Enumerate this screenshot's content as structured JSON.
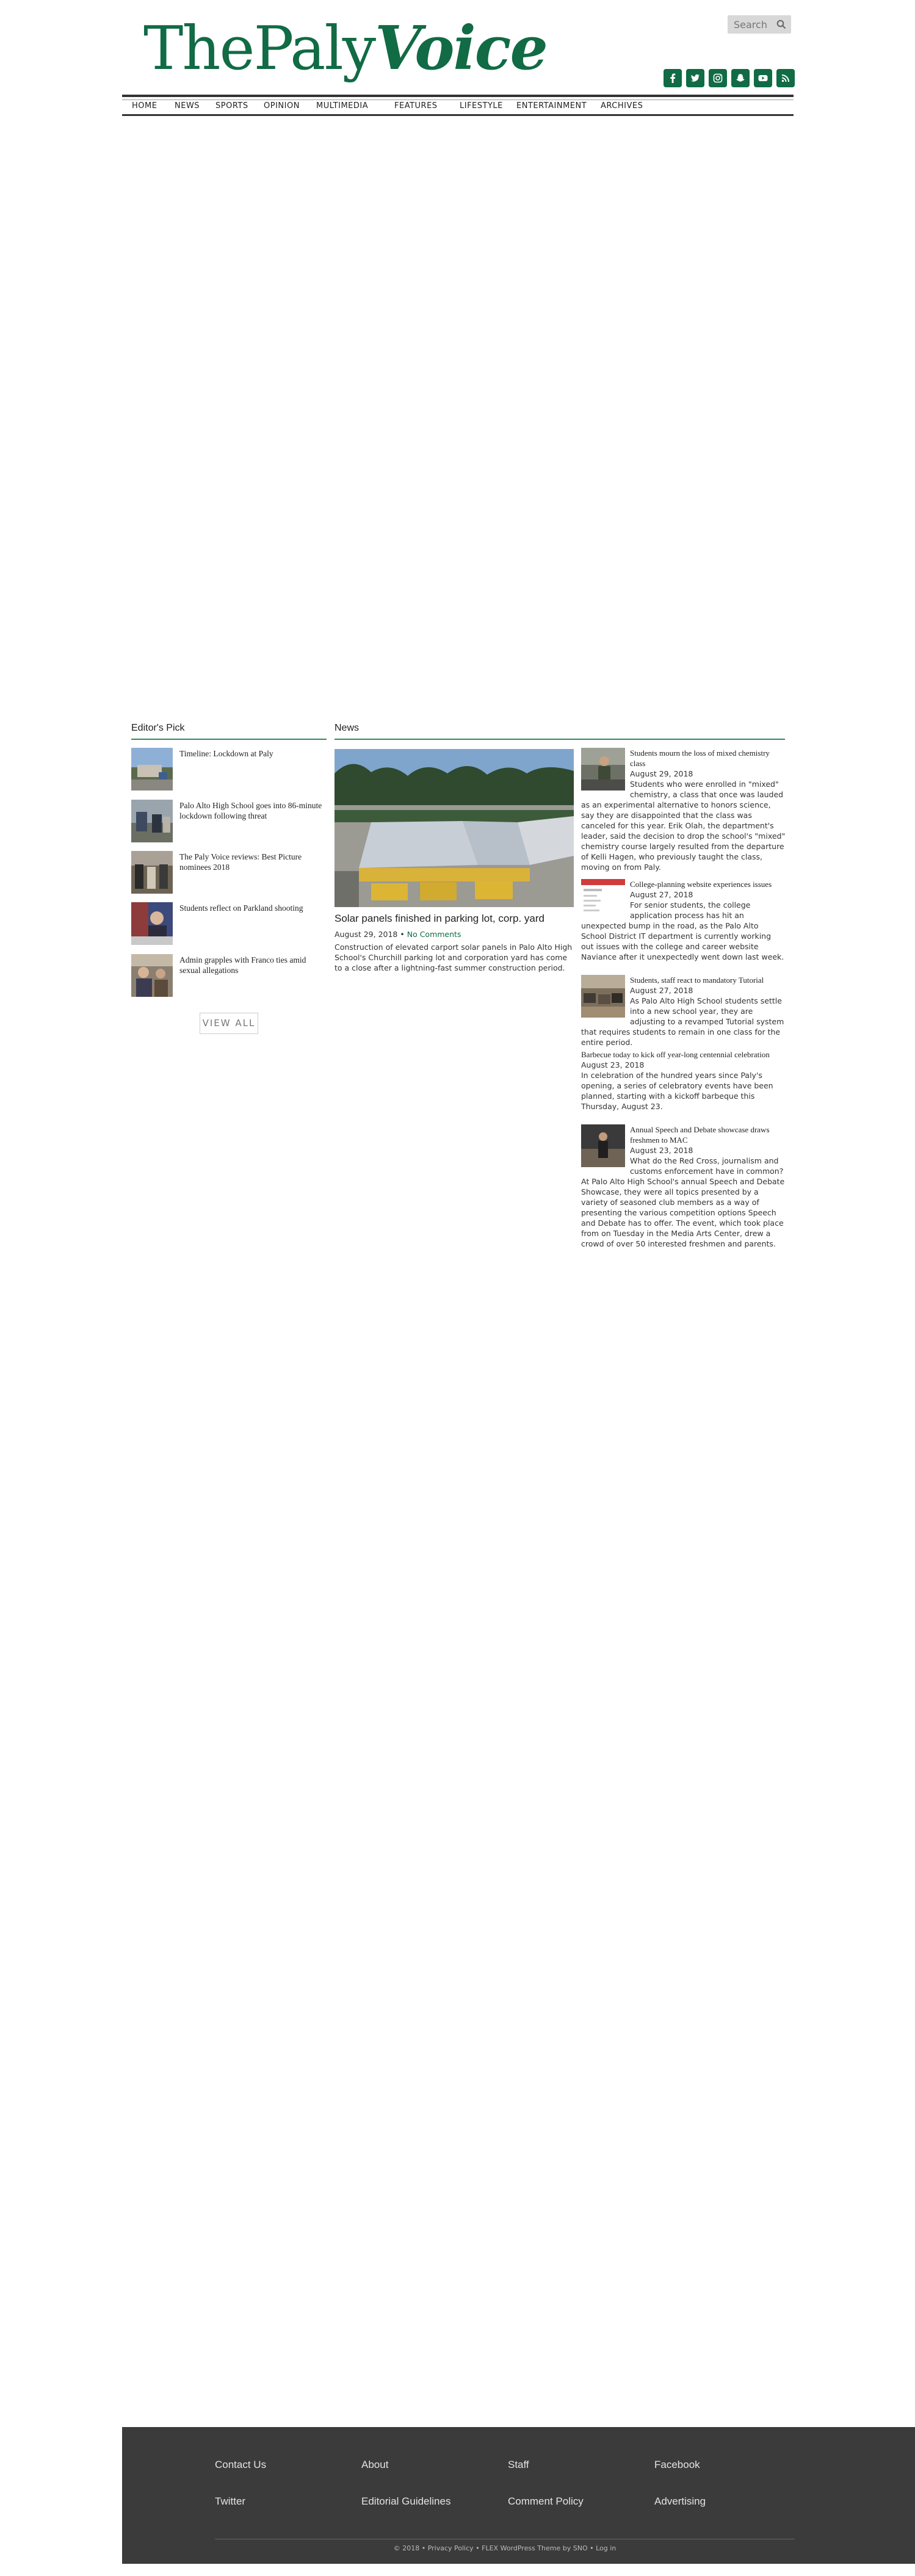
{
  "brand": {
    "logo_part1": "ThePaly",
    "logo_part2": "Voice",
    "brand_color": "#116b45"
  },
  "search": {
    "placeholder": "Search",
    "icon": "search-icon"
  },
  "social": [
    {
      "name": "facebook-icon"
    },
    {
      "name": "twitter-icon"
    },
    {
      "name": "instagram-icon"
    },
    {
      "name": "snapchat-icon"
    },
    {
      "name": "youtube-icon"
    },
    {
      "name": "rss-icon"
    }
  ],
  "nav": [
    "HOME",
    "NEWS",
    "SPORTS",
    "OPINION",
    "MULTIMEDIA",
    "FEATURES",
    "LIFESTYLE",
    "ENTERTAINMENT",
    "ARCHIVES"
  ],
  "editors_pick": {
    "title": "Editor's Pick",
    "items": [
      "Timeline: Lockdown at Paly",
      "Palo Alto High School goes into 86-minute lockdown following threat",
      "The Paly Voice reviews: Best Picture nominees 2018",
      "Students reflect on Parkland shooting",
      "Admin grapples with Franco ties amid sexual allegations"
    ],
    "view_all": "VIEW ALL"
  },
  "news": {
    "title": "News",
    "main": {
      "headline": "Solar panels finished in parking lot, corp. yard",
      "date": "August 29, 2018",
      "separator": "•",
      "comments": "No Comments",
      "excerpt": "Construction of elevated carport solar panels in Palo Alto High School's Churchill parking lot and corporation yard has come to a close after a lightning-fast summer construction period."
    },
    "side": [
      {
        "title": "Students mourn the loss of mixed chemistry class",
        "date": "August 29, 2018",
        "excerpt": "Students who were enrolled in \"mixed\" chemistry, a class that once was lauded as an experimental alternative to honors science, say they are disappointed that the class was canceled for this year. Erik Olah, the department's leader, said the decision to drop the school's \"mixed\" chemistry course largely resulted from the departure of Kelli Hagen, who previously taught the class, moving on from Paly."
      },
      {
        "title": "College-planning website experiences issues",
        "date": "August 27, 2018",
        "excerpt": "For senior students, the college application process has hit an unexpected bump in the road, as the Palo Alto School District IT department is currently working out issues with the college and career website Naviance after it unexpectedly went down last week."
      },
      {
        "title": "Students, staff react to mandatory Tutorial",
        "date": "August 27, 2018",
        "excerpt": "As Palo Alto High School students settle into a new school year, they are adjusting to a revamped Tutorial system that requires students to remain in one class for the entire period."
      },
      {
        "title": "Barbecue today to kick off year-long centennial celebration",
        "date": "August 23, 2018",
        "excerpt": "In celebration of the hundred years since Paly's opening, a series of celebratory events have been planned, starting with a kickoff barbeque this Thursday, August 23."
      },
      {
        "title": "Annual Speech and Debate showcase draws freshmen to MAC",
        "date": "August 23, 2018",
        "excerpt": "What do the Red Cross, journalism and customs enforcement have in common? At Palo Alto High School's annual Speech and Debate Showcase, they were all topics presented by a variety of seasoned club members as a way of presenting the various competition options Speech and Debate has to offer. The event, which took place from on Tuesday in the Media Arts Center, drew a crowd of over 50 interested freshmen and parents."
      }
    ]
  },
  "footer": {
    "links": [
      "Contact Us",
      "About",
      "Staff",
      "Facebook",
      "Twitter",
      "Editorial Guidelines",
      "Comment Policy",
      "Advertising"
    ],
    "copyright": "© 2018 • Privacy Policy • FLEX WordPress Theme by SNO • Log in"
  }
}
